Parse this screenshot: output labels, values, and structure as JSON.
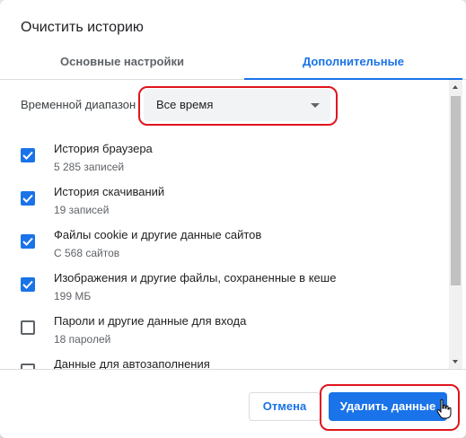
{
  "dialog": {
    "title": "Очистить историю"
  },
  "tabs": {
    "basic": "Основные настройки",
    "advanced": "Дополнительные",
    "active": "advanced"
  },
  "time_range": {
    "label": "Временной диапазон",
    "selected": "Все время"
  },
  "items": [
    {
      "title": "История браузера",
      "subtitle": "5 285 записей",
      "checked": true
    },
    {
      "title": "История скачиваний",
      "subtitle": "19 записей",
      "checked": true
    },
    {
      "title": "Файлы cookie и другие данные сайтов",
      "subtitle": "С 568 сайтов",
      "checked": true
    },
    {
      "title": "Изображения и другие файлы, сохраненные в кеше",
      "subtitle": "199 МБ",
      "checked": true
    },
    {
      "title": "Пароли и другие данные для входа",
      "subtitle": "18 паролей",
      "checked": false
    },
    {
      "title": "Данные для автозаполнения",
      "subtitle": "",
      "checked": false
    }
  ],
  "buttons": {
    "cancel": "Отмена",
    "delete": "Удалить данные"
  },
  "colors": {
    "accent": "#1a73e8",
    "highlight": "#e0141e"
  }
}
